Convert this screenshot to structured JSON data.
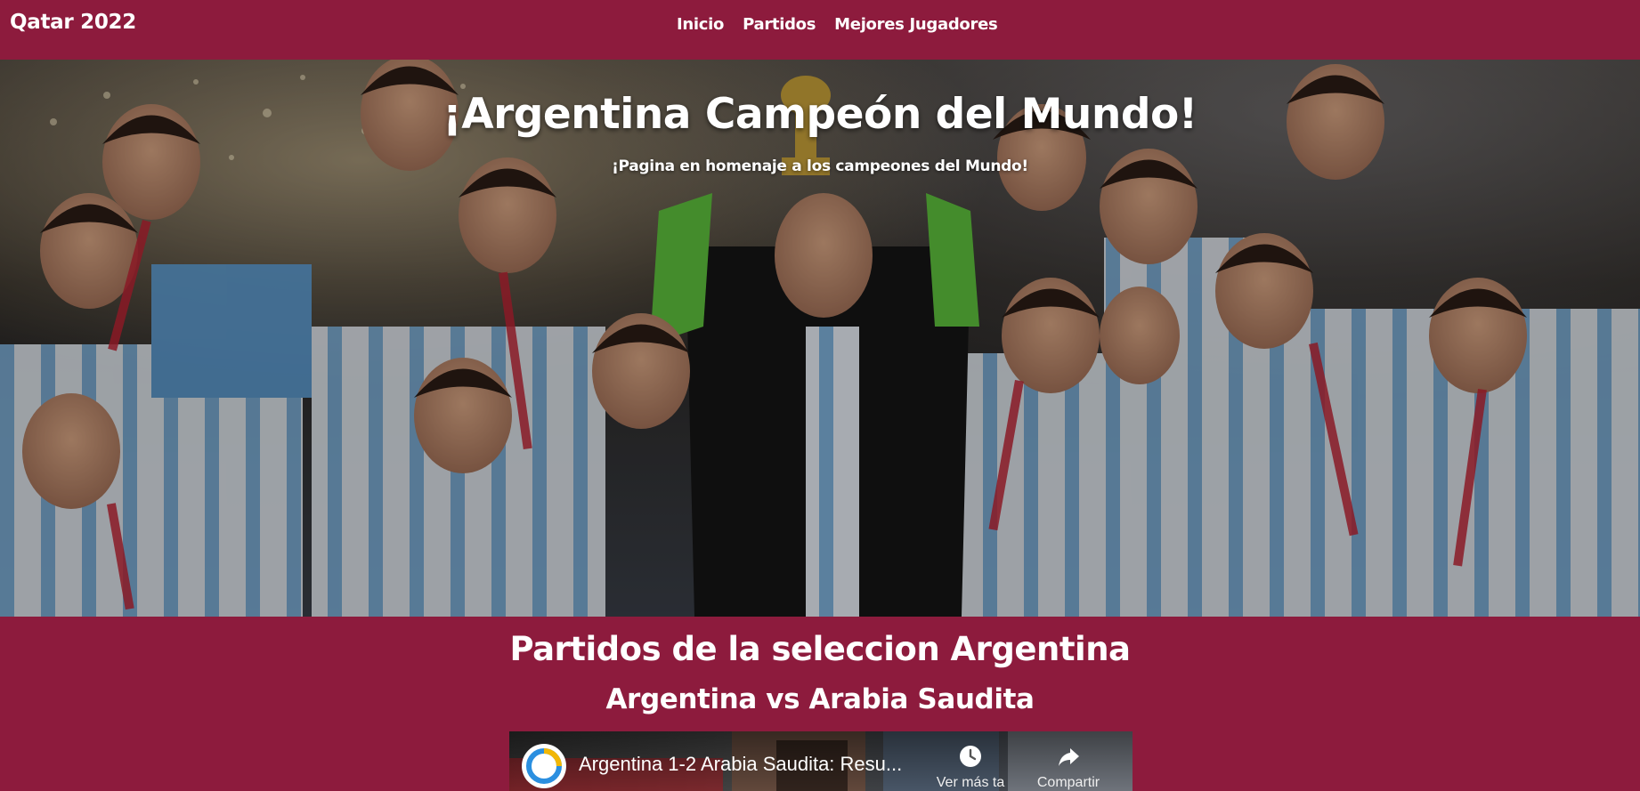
{
  "navbar": {
    "brand": "Qatar 2022",
    "links": [
      {
        "label": "Inicio"
      },
      {
        "label": "Partidos"
      },
      {
        "label": "Mejores Jugadores"
      }
    ]
  },
  "hero": {
    "title": "¡Argentina Campeón del Mundo!",
    "subtitle": "¡Pagina en homenaje a los campeones del Mundo!"
  },
  "matches": {
    "section_title": "Partidos de la seleccion Argentina",
    "match_title": "Argentina vs Arabia Saudita",
    "video": {
      "title": "Argentina 1-2 Arabia Saudita: Resu...",
      "watch_later_label": "Ver más ta",
      "share_label": "Compartir"
    }
  },
  "colors": {
    "brand_maroon": "#8d1b3d",
    "text": "#ffffff"
  }
}
